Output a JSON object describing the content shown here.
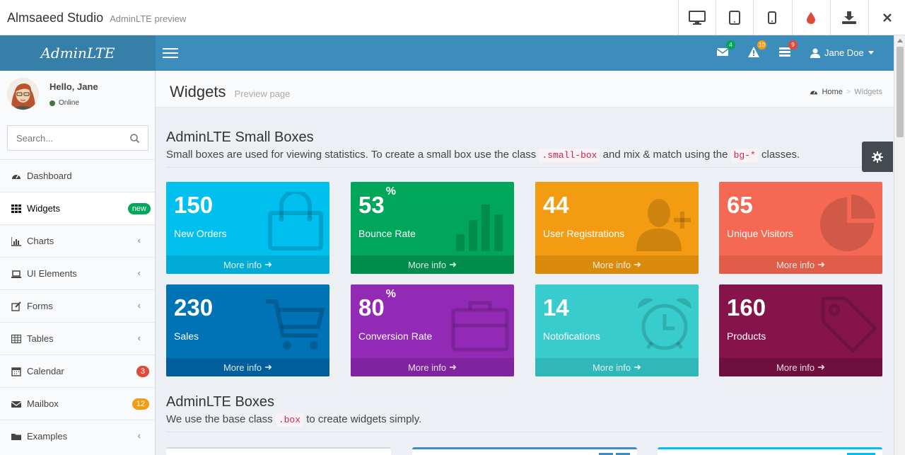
{
  "preview": {
    "title": "Almsaeed Studio",
    "subtitle": "AdminLTE preview",
    "buttons": [
      "desktop-icon",
      "tablet-icon",
      "mobile-icon",
      "color-drop-icon",
      "download-icon",
      "close-icon"
    ]
  },
  "header": {
    "logo": "AdminLTE",
    "badges": {
      "messages": "4",
      "notifications": "10",
      "tasks": "9"
    },
    "user_name": "Jane Doe"
  },
  "sidebar": {
    "greeting": "Hello, Jane",
    "status": "Online",
    "search_placeholder": "Search...",
    "items": [
      {
        "label": "Dashboard",
        "icon": "dashboard-icon"
      },
      {
        "label": "Widgets",
        "icon": "th-icon",
        "badge": "new",
        "active": true
      },
      {
        "label": "Charts",
        "icon": "bar-chart-icon",
        "chevron": true
      },
      {
        "label": "UI Elements",
        "icon": "laptop-icon",
        "chevron": true
      },
      {
        "label": "Forms",
        "icon": "edit-icon",
        "chevron": true
      },
      {
        "label": "Tables",
        "icon": "table-icon",
        "chevron": true
      },
      {
        "label": "Calendar",
        "icon": "calendar-icon",
        "badge": "3"
      },
      {
        "label": "Mailbox",
        "icon": "envelope-icon",
        "badge": "12"
      },
      {
        "label": "Examples",
        "icon": "folder-icon",
        "chevron": true
      }
    ]
  },
  "content": {
    "title": "Widgets",
    "subtitle": "Preview page",
    "breadcrumb": {
      "home": "Home",
      "current": "Widgets"
    },
    "small_boxes_section": {
      "title": "AdminLTE Small Boxes",
      "desc_1": "Small boxes are used for viewing statistics. To create a small box use the class",
      "code_1": ".small-box",
      "desc_2": "and mix & match using the",
      "code_2": "bg-*",
      "desc_3": "classes."
    },
    "boxes_section": {
      "title": "AdminLTE Boxes",
      "desc_1": "We use the base class",
      "code_1": ".box",
      "desc_2": "to create widgets simply."
    }
  },
  "small_boxes": [
    {
      "value": "150",
      "label": "New Orders",
      "footer": "More info",
      "icon": "shopping-bag-icon",
      "color": "#00c0ef",
      "footer_color": "#00acd6"
    },
    {
      "value": "53",
      "suffix": "%",
      "label": "Bounce Rate",
      "footer": "More info",
      "icon": "bar-chart-icon",
      "color": "#00a65a",
      "footer_color": "#008d4c"
    },
    {
      "value": "44",
      "label": "User Registrations",
      "footer": "More info",
      "icon": "user-add-icon",
      "color": "#f39c12",
      "footer_color": "#db8b0b"
    },
    {
      "value": "65",
      "label": "Unique Visitors",
      "footer": "More info",
      "icon": "pie-chart-icon",
      "color": "#f56954",
      "footer_color": "#e05d4a"
    },
    {
      "value": "230",
      "label": "Sales",
      "footer": "More info",
      "icon": "shopping-cart-icon",
      "color": "#0073b7",
      "footer_color": "#005f9a"
    },
    {
      "value": "80",
      "suffix": "%",
      "label": "Conversion Rate",
      "footer": "More info",
      "icon": "briefcase-icon",
      "color": "#932ab6",
      "footer_color": "#7f239e"
    },
    {
      "value": "14",
      "label": "Notofications",
      "footer": "More info",
      "icon": "alarm-clock-icon",
      "color": "#39cccc",
      "footer_color": "#30b7b7"
    },
    {
      "value": "160",
      "label": "Products",
      "footer": "More info",
      "icon": "tag-icon",
      "color": "#85144b",
      "footer_color": "#6f0f3d"
    }
  ]
}
